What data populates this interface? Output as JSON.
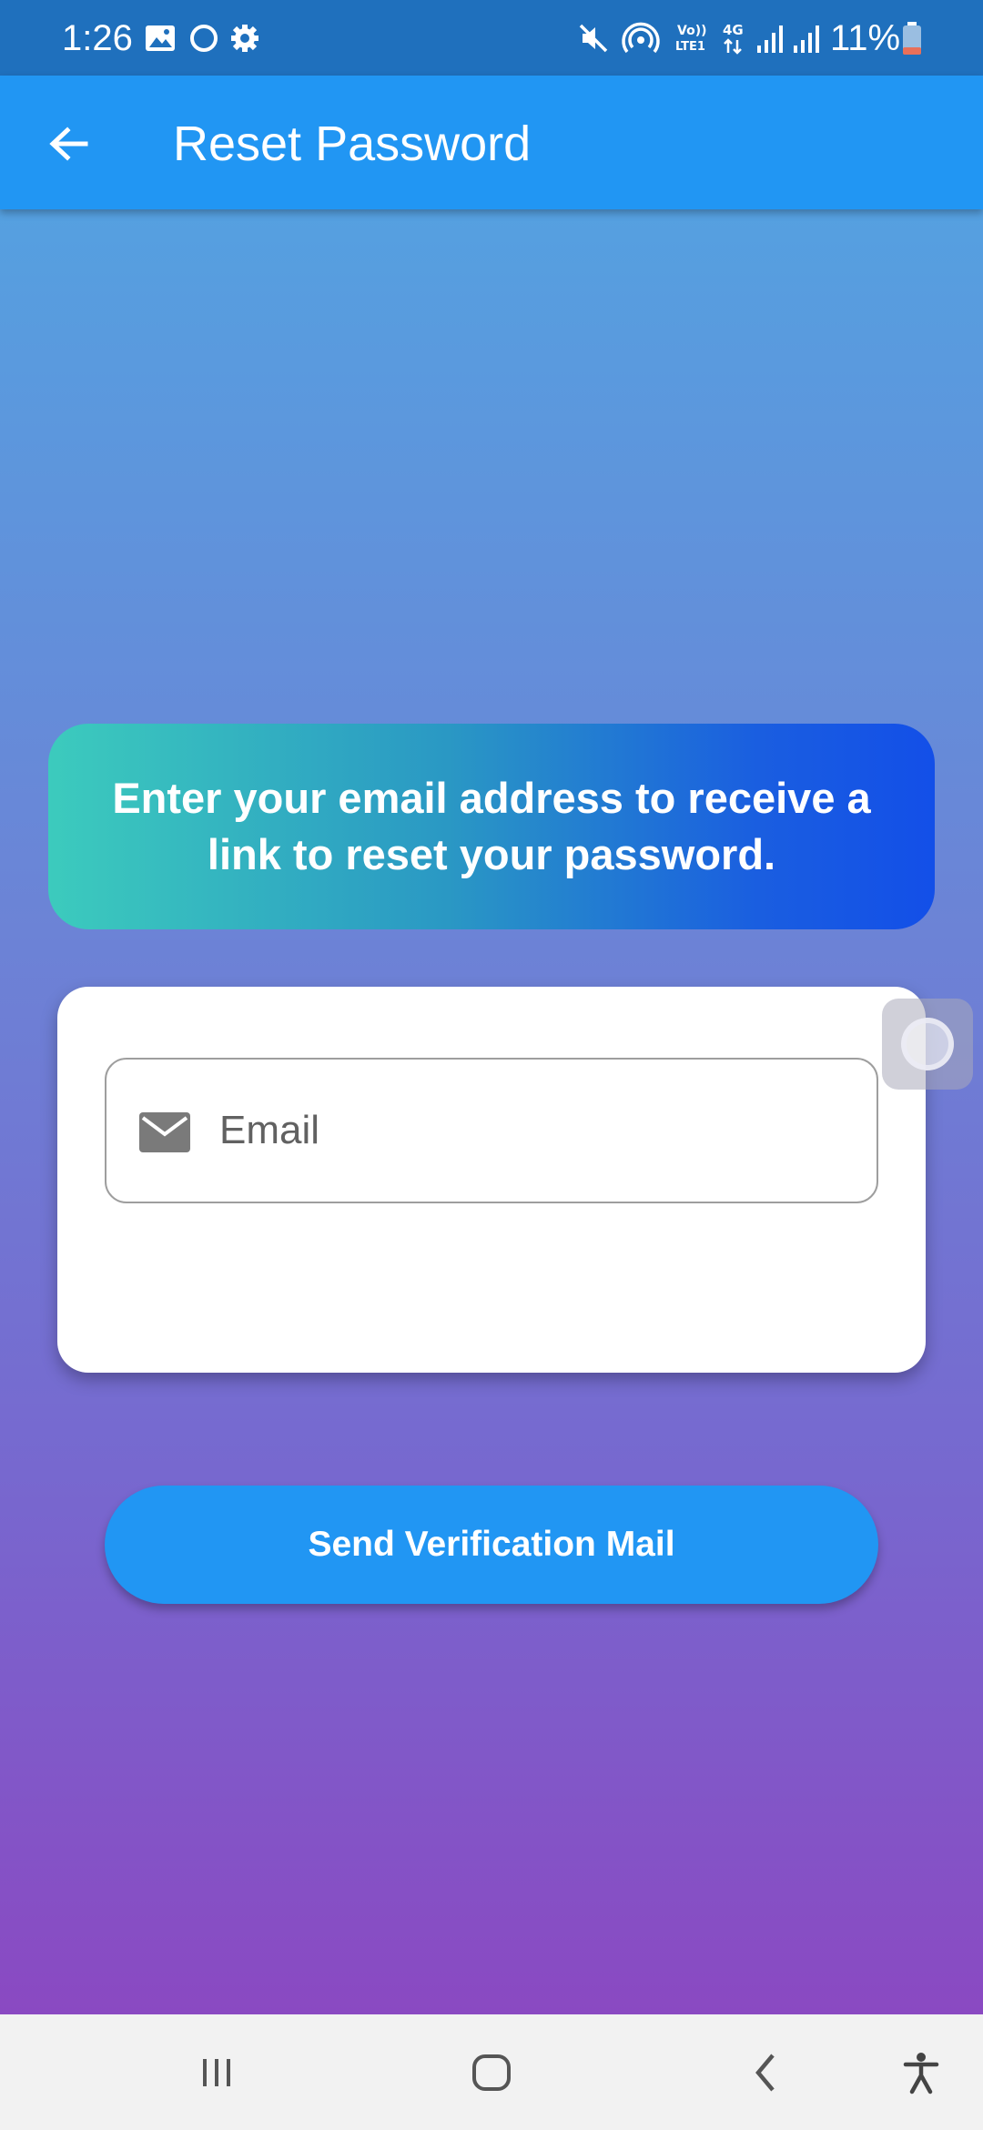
{
  "status_bar": {
    "time": "1:26",
    "battery_percent": "11%",
    "icons": [
      "gallery-icon",
      "circle-icon",
      "settings-icon",
      "mute-icon",
      "hotspot-icon",
      "volte-icon",
      "4g-icon",
      "signal-icon",
      "signal-icon",
      "battery-icon"
    ]
  },
  "app_bar": {
    "title": "Reset Password",
    "back_icon": "arrow-back-icon"
  },
  "info_banner": {
    "text": "Enter your email address to receive a link to reset your password."
  },
  "form": {
    "email_placeholder": "Email",
    "email_value": "",
    "email_icon": "mail-icon",
    "send_button_label": "Send Verification Mail"
  },
  "colors": {
    "primary": "#2196f3",
    "status_bar": "#1f70bd",
    "background_top": "#55a0e0",
    "background_bottom": "#8a49c2",
    "banner_start": "#3ccbbd",
    "banner_end": "#134fe8"
  },
  "nav_bar": {
    "icons": [
      "recents-icon",
      "home-icon",
      "back-icon",
      "accessibility-icon"
    ]
  }
}
